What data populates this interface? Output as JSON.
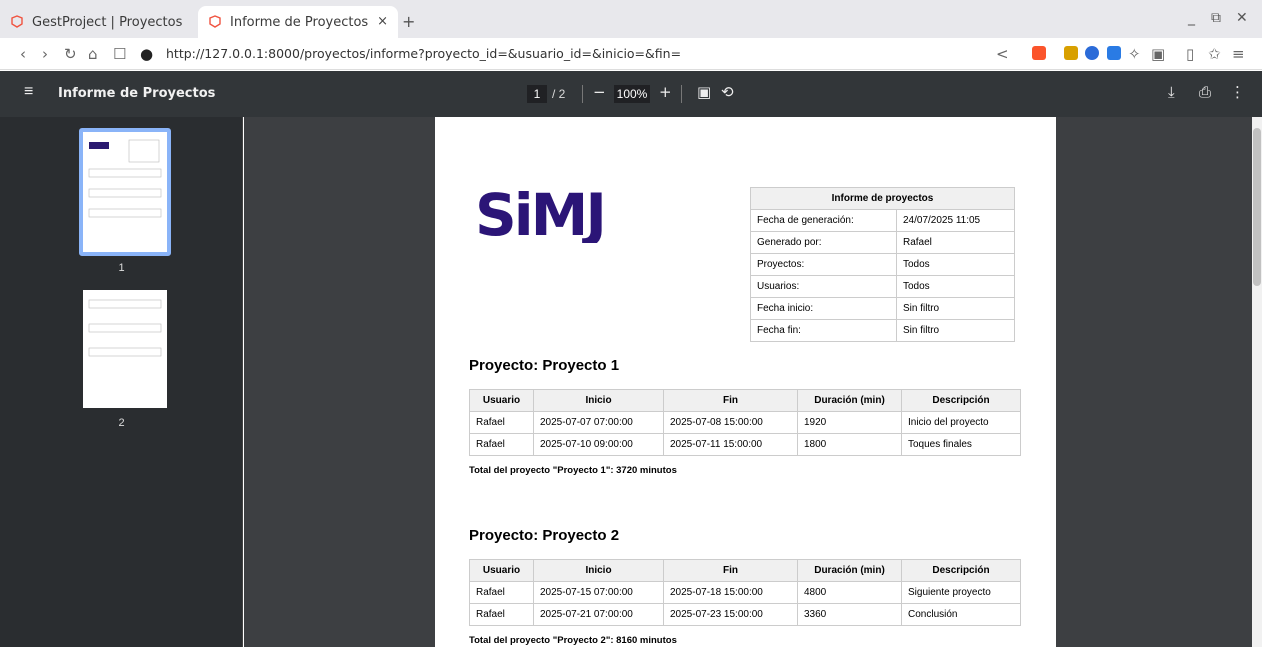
{
  "browser": {
    "tabs": [
      {
        "title": "GestProject | Proyectos"
      },
      {
        "title": "Informe de Proyectos",
        "close": "×"
      }
    ],
    "new_tab": "+",
    "url": "http://127.0.0.1:8000/proyectos/informe?proyecto_id=&usuario_id=&inicio=&fin="
  },
  "viewer": {
    "title": "Informe de Proyectos",
    "current_page": "1",
    "total_pages": "/ 2",
    "zoom": "100%",
    "zoom_out": "−",
    "zoom_in": "+",
    "thumbnails": [
      {
        "label": "1"
      },
      {
        "label": "2"
      }
    ]
  },
  "report": {
    "logo_text": "SiMJ",
    "info": {
      "header": "Informe de proyectos",
      "rows": [
        {
          "key": "Fecha de generación:",
          "value": "24/07/2025 11:05"
        },
        {
          "key": "Generado por:",
          "value": "Rafael"
        },
        {
          "key": "Proyectos:",
          "value": "Todos"
        },
        {
          "key": "Usuarios:",
          "value": "Todos"
        },
        {
          "key": "Fecha inicio:",
          "value": "Sin filtro"
        },
        {
          "key": "Fecha fin:",
          "value": "Sin filtro"
        }
      ]
    },
    "columns": [
      "Usuario",
      "Inicio",
      "Fin",
      "Duración (min)",
      "Descripción"
    ],
    "projects": [
      {
        "title": "Proyecto: Proyecto 1",
        "rows": [
          [
            "Rafael",
            "2025-07-07 07:00:00",
            "2025-07-08 15:00:00",
            "1920",
            "Inicio del proyecto"
          ],
          [
            "Rafael",
            "2025-07-10 09:00:00",
            "2025-07-11 15:00:00",
            "1800",
            "Toques finales"
          ]
        ],
        "total": "Total del proyecto \"Proyecto 1\": 3720 minutos"
      },
      {
        "title": "Proyecto: Proyecto 2",
        "rows": [
          [
            "Rafael",
            "2025-07-15 07:00:00",
            "2025-07-18 15:00:00",
            "4800",
            "Siguiente proyecto"
          ],
          [
            "Rafael",
            "2025-07-21 07:00:00",
            "2025-07-23 15:00:00",
            "3360",
            "Conclusión"
          ]
        ],
        "total": "Total del proyecto \"Proyecto 2\": 8160 minutos"
      }
    ]
  }
}
